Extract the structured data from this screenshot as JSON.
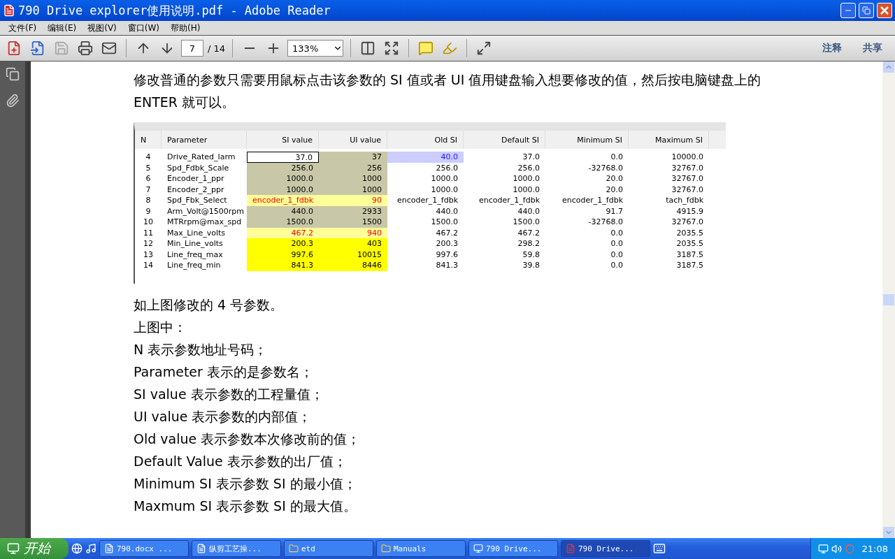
{
  "window": {
    "title": "790 Drive explorer使用说明.pdf - Adobe Reader"
  },
  "menu": [
    {
      "label": "文件(F)"
    },
    {
      "label": "编辑(E)"
    },
    {
      "label": "视图(V)"
    },
    {
      "label": "窗口(W)"
    },
    {
      "label": "帮助(H)"
    }
  ],
  "toolbar": {
    "page": "7",
    "page_total": "/ 14",
    "zoom": "133%",
    "tabs": [
      {
        "label": "注释"
      },
      {
        "label": "共享"
      }
    ]
  },
  "document": {
    "intro": "修改普通的参数只需要用鼠标点击该参数的 SI 值或者 UI 值用键盘输入想要修改的值，然后按电脑键盘上的 ENTER 就可以。",
    "table": {
      "columns": [
        "N",
        "Parameter",
        "SI value",
        "UI value",
        "Old SI",
        "Default SI",
        "Minimum SI",
        "Maximum SI"
      ],
      "rows": [
        {
          "cells": [
            "4",
            "Drive_Rated_Iarm",
            "37.0",
            "37",
            "40.0",
            "37.0",
            "0.0",
            "10000.0"
          ],
          "kind": "stored",
          "editing": true,
          "old_marked": true
        },
        {
          "cells": [
            "5",
            "Spd_Fdbk_Scale",
            "256.0",
            "256",
            "256.0",
            "256.0",
            "-32768.0",
            "32767.0"
          ],
          "kind": "stored",
          "editing": false,
          "old_marked": false
        },
        {
          "cells": [
            "6",
            "Encoder_1_ppr",
            "1000.0",
            "1000",
            "1000.0",
            "1000.0",
            "20.0",
            "32767.0"
          ],
          "kind": "stored",
          "editing": false,
          "old_marked": false
        },
        {
          "cells": [
            "7",
            "Encoder_2_ppr",
            "1000.0",
            "1000",
            "1000.0",
            "1000.0",
            "20.0",
            "32767.0"
          ],
          "kind": "stored",
          "editing": false,
          "old_marked": false
        },
        {
          "cells": [
            "8",
            "Spd_Fbk_Select",
            "encoder_1_fdbk",
            "90",
            "encoder_1_fdbk",
            "encoder_1_fdbk",
            "encoder_1_fdbk",
            "tach_fdbk"
          ],
          "kind": "changed",
          "editing": false,
          "old_marked": false
        },
        {
          "cells": [
            "9",
            "Arm_Volt@1500rpm",
            "440.0",
            "2933",
            "440.0",
            "440.0",
            "91.7",
            "4915.9"
          ],
          "kind": "stored",
          "editing": false,
          "old_marked": false
        },
        {
          "cells": [
            "10",
            "MTRrpm@max_spd",
            "1500.0",
            "1500",
            "1500.0",
            "1500.0",
            "-32768.0",
            "32767.0"
          ],
          "kind": "stored",
          "editing": false,
          "old_marked": false
        },
        {
          "cells": [
            "11",
            "Max_Line_volts",
            "467.2",
            "940",
            "467.2",
            "467.2",
            "0.0",
            "2035.5"
          ],
          "kind": "changed",
          "editing": false,
          "old_marked": false
        },
        {
          "cells": [
            "12",
            "Min_Line_volts",
            "200.3",
            "403",
            "200.3",
            "298.2",
            "0.0",
            "2035.5"
          ],
          "kind": "differs",
          "editing": false,
          "old_marked": false
        },
        {
          "cells": [
            "13",
            "Line_freq_max",
            "997.6",
            "10015",
            "997.6",
            "59.8",
            "0.0",
            "3187.5"
          ],
          "kind": "differs",
          "editing": false,
          "old_marked": false
        },
        {
          "cells": [
            "14",
            "Line_freq_min",
            "841.3",
            "8446",
            "841.3",
            "39.8",
            "0.0",
            "3187.5"
          ],
          "kind": "differs",
          "editing": false,
          "old_marked": false
        }
      ]
    },
    "lines": [
      "如上图修改的 4 号参数。",
      "上图中：",
      "N  表示参数地址号码；",
      "Parameter 表示的是参数名；",
      "SI value  表示参数的工程量值；",
      "UI value 表示参数的内部值；",
      "Old value  表示参数本次修改前的值；",
      "Default Value 表示参数的出厂值；",
      "Minimum SI  表示参数 SI  的最小值；",
      "Maxmum SI  表示参数 SI  的最大值。"
    ]
  },
  "taskbar": {
    "start": "开始",
    "tasks": [
      {
        "label": "790.docx ...",
        "kind": "document",
        "selected": false
      },
      {
        "label": "纵剪工艺操...",
        "kind": "document",
        "selected": false
      },
      {
        "label": "etd",
        "kind": "folder",
        "selected": false
      },
      {
        "label": "Manuals",
        "kind": "folder",
        "selected": false
      },
      {
        "label": "790 Drive...",
        "kind": "program",
        "selected": false
      },
      {
        "label": "790 Drive...",
        "kind": "reader",
        "selected": true
      }
    ],
    "clock": "21:08"
  }
}
